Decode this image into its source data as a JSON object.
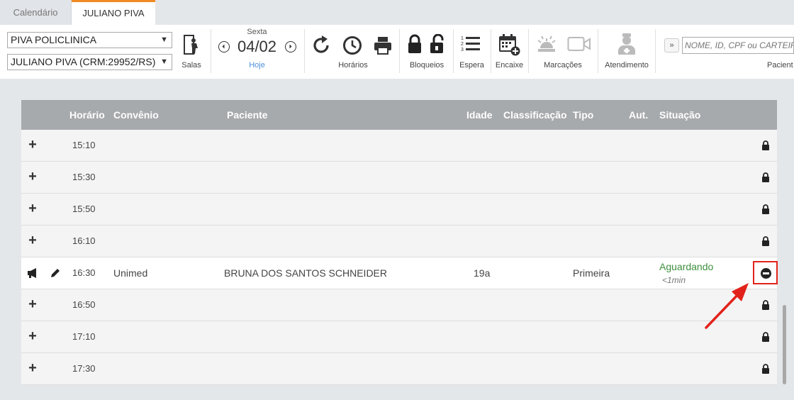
{
  "tabs": [
    {
      "label": "Calendário",
      "active": false
    },
    {
      "label": "JULIANO PIVA",
      "active": true
    }
  ],
  "toolbar": {
    "clinic_select": "PIVA POLICLINICA",
    "doctor_select": "JULIANO PIVA (CRM:29952/RS)",
    "salas_label": "Salas",
    "date": {
      "day": "Sexta",
      "value": "04/02",
      "today_label": "Hoje"
    },
    "horarios_label": "Horários",
    "bloqueios_label": "Bloqueios",
    "espera_label": "Espera",
    "encaixe_label": "Encaixe",
    "marcacoes_label": "Marcações",
    "atendimento_label": "Atendimento",
    "search": {
      "toggle": "»",
      "placeholder": "NOME, ID, CPF ou CARTEIRA",
      "label": "Pacient"
    }
  },
  "table": {
    "columns": {
      "horario": "Horário",
      "convenio": "Convênio",
      "paciente": "Paciente",
      "idade": "Idade",
      "classificacao": "Classificação",
      "tipo": "Tipo",
      "aut": "Aut.",
      "situacao": "Situação"
    },
    "rows": [
      {
        "time": "15:10",
        "state": "blocked"
      },
      {
        "time": "15:30",
        "state": "blocked"
      },
      {
        "time": "15:50",
        "state": "blocked"
      },
      {
        "time": "16:10",
        "state": "blocked"
      },
      {
        "time": "16:30",
        "state": "booked",
        "convenio": "Unimed",
        "paciente": "BRUNA DOS SANTOS SCHNEIDER",
        "idade": "19a",
        "tipo": "Primeira",
        "situacao": "Aguardando",
        "situacao_sub": "<1min"
      },
      {
        "time": "16:50",
        "state": "blocked"
      },
      {
        "time": "17:10",
        "state": "blocked"
      },
      {
        "time": "17:30",
        "state": "blocked"
      }
    ]
  },
  "colors": {
    "accent": "#f08a24",
    "status_green": "#3d8f3d",
    "highlight_red": "#e2221a",
    "header_gray": "#a7aaad"
  }
}
